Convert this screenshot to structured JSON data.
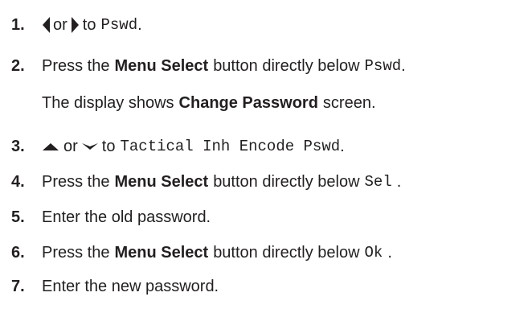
{
  "steps": [
    {
      "num": "1.",
      "or": "or",
      "to": "to",
      "code": "Pswd",
      "end": "."
    },
    {
      "num": "2.",
      "pre": "Press the",
      "bold": "Menu Select",
      "mid": "button directly below",
      "code": "Pswd",
      "end": ".",
      "cont_pre": "The display shows",
      "cont_bold": "Change Password",
      "cont_post": "screen."
    },
    {
      "num": "3.",
      "or": "or",
      "to": "to",
      "code": "Tactical Inh Encode Pswd",
      "end": "."
    },
    {
      "num": "4.",
      "pre": "Press the",
      "bold": "Menu Select",
      "mid": "button directly below",
      "code": "Sel",
      "end": "."
    },
    {
      "num": "5.",
      "text": "Enter the old password."
    },
    {
      "num": "6.",
      "pre": "Press the",
      "bold": "Menu Select",
      "mid": "button directly below",
      "code": "Ok",
      "end": "."
    },
    {
      "num": "7.",
      "text": "Enter the new password."
    }
  ],
  "icons": {
    "left": "arrow-left-icon",
    "right": "arrow-right-icon",
    "up": "arrow-up-icon",
    "down": "arrow-down-icon"
  }
}
